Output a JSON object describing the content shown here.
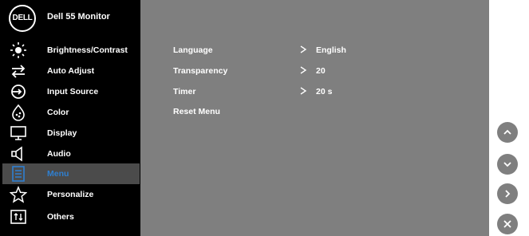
{
  "header": {
    "logo": "DELL",
    "title": "Dell 55 Monitor"
  },
  "sidebar": {
    "items": [
      {
        "label": "Brightness/Contrast",
        "icon": "brightness-icon"
      },
      {
        "label": "Auto Adjust",
        "icon": "auto-adjust-icon"
      },
      {
        "label": "Input Source",
        "icon": "input-source-icon"
      },
      {
        "label": "Color",
        "icon": "color-icon"
      },
      {
        "label": "Display",
        "icon": "display-icon"
      },
      {
        "label": "Audio",
        "icon": "audio-icon"
      },
      {
        "label": "Menu",
        "icon": "menu-icon",
        "active": true
      },
      {
        "label": "Personalize",
        "icon": "star-icon"
      },
      {
        "label": "Others",
        "icon": "others-icon"
      }
    ]
  },
  "main": {
    "rows": [
      {
        "label": "Language",
        "value": "English"
      },
      {
        "label": "Transparency",
        "value": "20"
      },
      {
        "label": "Timer",
        "value": "20 s"
      },
      {
        "label": "Reset Menu",
        "value": ""
      }
    ]
  },
  "nav_buttons": [
    "up",
    "down",
    "right",
    "close"
  ],
  "colors": {
    "accent": "#2f7fd0",
    "panel": "#7f7f7f",
    "sidebar": "#000000",
    "active_bg": "#4b4b4b"
  }
}
